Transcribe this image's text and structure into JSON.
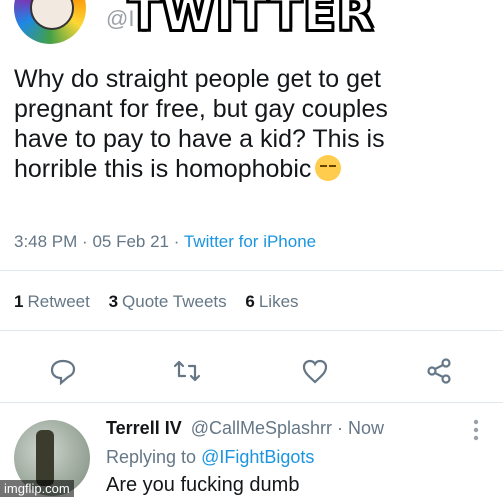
{
  "top": {
    "handle_partial": "@I",
    "meme_title": "TWITTER"
  },
  "tweet": {
    "text": "Why do straight people get to get\npregnant for free, but gay couples\nhave to pay to have a kid? This is\nhorrible this is homophobic",
    "emoji_icon": "pensive-face-icon",
    "time": "3:48 PM",
    "date": "05 Feb 21",
    "separator": "·",
    "source": "Twitter for iPhone"
  },
  "stats": {
    "retweets_count": "1",
    "retweets_label": "Retweet",
    "quote_count": "3",
    "quote_label": "Quote Tweets",
    "likes_count": "6",
    "likes_label": "Likes"
  },
  "actions": [
    "reply-icon",
    "retweet-icon",
    "like-icon",
    "share-icon"
  ],
  "reply": {
    "name": "Terrell IV",
    "handle": "@CallMeSplashrr",
    "time": "· Now",
    "replying_prefix": "Replying to",
    "replying_to": "@IFightBigots",
    "text": "Are you fucking dumb"
  },
  "watermark": "imgflip.com",
  "colors": {
    "link": "#1b95e0",
    "muted": "#657786",
    "text": "#14171a"
  }
}
